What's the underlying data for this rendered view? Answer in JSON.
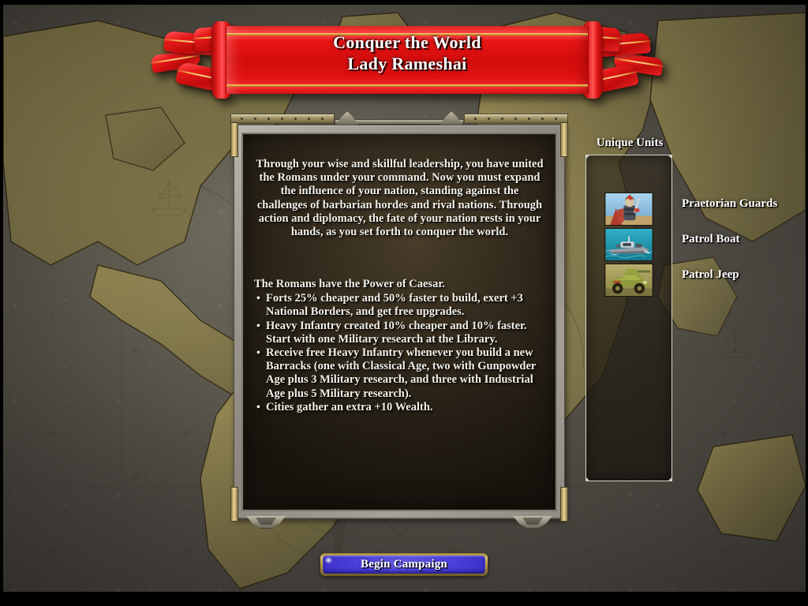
{
  "window": {
    "title": "Conquer the World"
  },
  "banner": {
    "title_line1": "Conquer the World",
    "title_line2": "Lady Rameshai",
    "title_combined": "Conquer the World\nLady Rameshai",
    "color": "#e01212",
    "accent_color": "#e5c45e"
  },
  "panel": {
    "intro_text": "Through your wise and skillful leadership, you have united the Romans under your command. Now you must expand the influence of your nation, standing against the challenges of barbarian hordes and rival nations. Through action and diplomacy, the fate of your nation rests in your hands, as you set forth to conquer the world.",
    "power_heading": "The Romans have the Power of Caesar.",
    "bullet_glyph": "•",
    "bullets": [
      "Forts 25% cheaper and 50% faster to build, exert +3 National Borders, and get free upgrades.",
      "Heavy Infantry created 10% cheaper and 10% faster. Start with one Military research at the Library.",
      "Receive free Heavy Infantry whenever you build a new Barracks (one with Classical Age, two with Gunpowder Age plus 3 Military research, and three with Industrial Age plus 5 Military research).",
      "Cities gather an extra +10 Wealth."
    ]
  },
  "unique_units": {
    "title": "Unique Units",
    "items": [
      {
        "name": "Praetorian Guards",
        "icon": "roman-legionary-icon",
        "thumb_bg": "#7fb6dd",
        "thumb_accent": "#c0392b"
      },
      {
        "name": "Patrol Boat",
        "icon": "patrol-boat-icon",
        "thumb_bg": "#1f9bb8",
        "thumb_accent": "#8d9398"
      },
      {
        "name": "Patrol Jeep",
        "icon": "patrol-jeep-icon",
        "thumb_bg": "#9d9a58",
        "thumb_accent": "#7f8a3a"
      }
    ]
  },
  "actions": {
    "begin_campaign_label": "Begin Campaign",
    "begin_campaign_color": "#3a2ec6"
  },
  "background": {
    "kind": "antique-world-map",
    "ocean_color": "#5f5b50",
    "land_color": "#8d8250"
  }
}
